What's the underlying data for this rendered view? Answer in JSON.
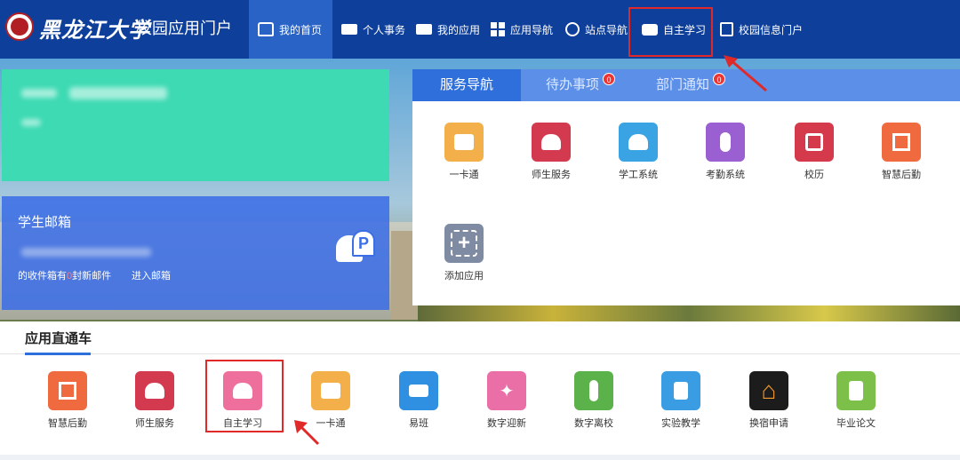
{
  "header": {
    "brand": "黑龙江大学",
    "portal_title": "校园应用门户",
    "nav": [
      {
        "label": "我的首页",
        "icon": "home-icon"
      },
      {
        "label": "个人事务",
        "icon": "monitor-icon"
      },
      {
        "label": "我的应用",
        "icon": "monitor-icon"
      },
      {
        "label": "应用导航",
        "icon": "grid-icon"
      },
      {
        "label": "站点导航",
        "icon": "compass-icon"
      },
      {
        "label": "自主学习",
        "icon": "briefcase-icon"
      },
      {
        "label": "校园信息门户",
        "icon": "document-icon"
      }
    ]
  },
  "mail": {
    "title": "学生邮箱",
    "count_prefix": "的收件箱有",
    "count": "0",
    "count_suffix": "封新邮件",
    "enter": "进入邮箱"
  },
  "panel": {
    "tabs": [
      {
        "label": "服务导航"
      },
      {
        "label": "待办事项",
        "badge": "0"
      },
      {
        "label": "部门通知",
        "badge": "0"
      }
    ],
    "apps": [
      {
        "label": "一卡通",
        "color": "#f3b04a",
        "icon": "id-card-icon"
      },
      {
        "label": "师生服务",
        "color": "#d33a4f",
        "icon": "people-icon"
      },
      {
        "label": "学工系统",
        "color": "#3aa3e3",
        "icon": "user-gear-icon"
      },
      {
        "label": "考勤系统",
        "color": "#9a5fd0",
        "icon": "touch-icon"
      },
      {
        "label": "校历",
        "color": "#d43a4c",
        "icon": "calendar-icon"
      },
      {
        "label": "智慧后勤",
        "color": "#f06a40",
        "icon": "building-icon"
      },
      {
        "label": "添加应用",
        "color": "#7f8aa3",
        "icon": "add-icon"
      }
    ]
  },
  "quick": {
    "title": "应用直通车",
    "apps": [
      {
        "label": "智慧后勤",
        "color": "#f06a40",
        "icon": "building-icon"
      },
      {
        "label": "师生服务",
        "color": "#d33a4f",
        "icon": "people-icon"
      },
      {
        "label": "自主学习",
        "color": "#ef6f9c",
        "icon": "reader-icon"
      },
      {
        "label": "一卡通",
        "color": "#f3b04a",
        "icon": "id-card-icon"
      },
      {
        "label": "易班",
        "color": "#2f8fe0",
        "icon": "mail-icon"
      },
      {
        "label": "数字迎新",
        "color": "#ea6fa6",
        "icon": "stars-icon"
      },
      {
        "label": "数字离校",
        "color": "#5bb24a",
        "icon": "walker-icon"
      },
      {
        "label": "实验教学",
        "color": "#3a9de3",
        "icon": "lectern-icon"
      },
      {
        "label": "换宿申请",
        "color": "#1c1c1c",
        "icon": "house-icon"
      },
      {
        "label": "毕业论文",
        "color": "#7cc04a",
        "icon": "certificate-icon"
      }
    ]
  }
}
